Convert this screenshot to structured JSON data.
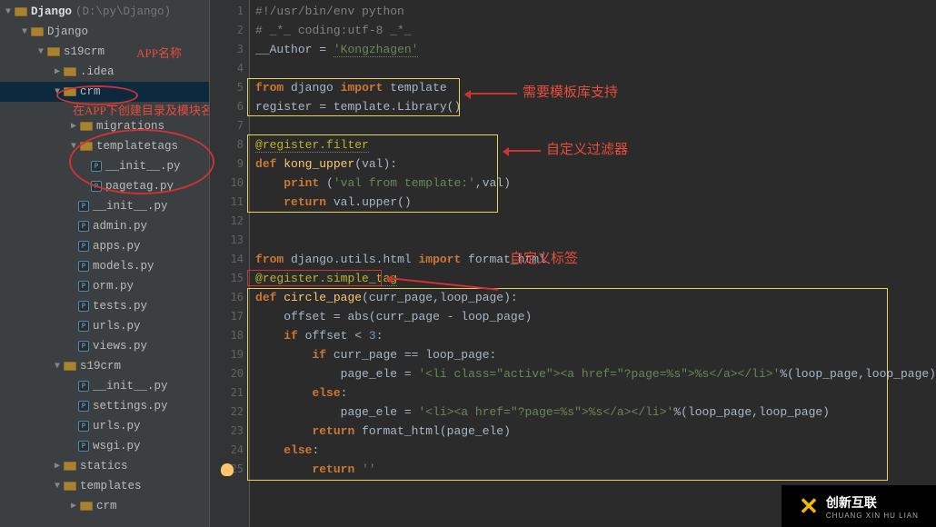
{
  "project": {
    "name": "Django",
    "path": "(D:\\py\\Django)"
  },
  "tree": {
    "node0": "Django",
    "node1": "Django",
    "node2": "s19crm",
    "node3": ".idea",
    "node4": "crm",
    "node5": "migrations",
    "node6": "templatetags",
    "node7": "__init__.py",
    "node8": "pagetag.py",
    "node9": "__init__.py",
    "node10": "admin.py",
    "node11": "apps.py",
    "node12": "models.py",
    "node13": "orm.py",
    "node14": "tests.py",
    "node15": "urls.py",
    "node16": "views.py",
    "node17": "s19crm",
    "node18": "__init__.py",
    "node19": "settings.py",
    "node20": "urls.py",
    "node21": "wsgi.py",
    "node22": "statics",
    "node23": "templates",
    "node24": "crm"
  },
  "ann": {
    "app_name": "APP名称",
    "create_dir": "在APP下创建目录及模块名",
    "need_lib": "需要模板库支持",
    "custom_filter": "自定义过滤器",
    "custom_tag": "自定义标签"
  },
  "code": {
    "l1": "#!/usr/bin/env python",
    "l2": "# _*_ coding:utf-8 _*_",
    "l3a": "__Author = ",
    "l3b": "'Kongzhagen'",
    "l5a": "from",
    "l5b": " django ",
    "l5c": "import",
    "l5d": " template",
    "l6": "register = template.Library()",
    "l8": "@register.filter",
    "l9a": "def ",
    "l9b": "kong_upper",
    "l9c": "(val):",
    "l10a": "print",
    "l10b": " (",
    "l10c": "'val from template:'",
    "l10d": ",val)",
    "l11a": "return",
    "l11b": " val.upper()",
    "l14a": "from",
    "l14b": " django.utils.html ",
    "l14c": "import",
    "l14d": " format_html",
    "l15": "@register.simple_tag",
    "l16a": "def ",
    "l16b": "circle_page",
    "l16c": "(curr_page,loop_page):",
    "l17": "offset = abs(curr_page - loop_page)",
    "l18a": "if",
    "l18b": " offset < ",
    "l18c": "3",
    "l18d": ":",
    "l19a": "if",
    "l19b": " curr_page == loop_page:",
    "l20a": "page_ele = ",
    "l20b": "'<li class=\"active\"><a href=\"?page=%s\">%s</a></li>'",
    "l20c": "%(loop_page,loop_page)",
    "l21": "else",
    "l22a": "page_ele = ",
    "l22b": "'<li><a href=\"?page=%s\">%s</a></li>'",
    "l22c": "%(loop_page,loop_page)",
    "l23a": "return",
    "l23b": " format_html(page_ele)",
    "l24": "else",
    "l25a": "return ",
    "l25b": "''"
  },
  "watermark": {
    "brand": "创新互联",
    "sub": "CHUANG XIN HU LIAN"
  },
  "linecount": 25
}
